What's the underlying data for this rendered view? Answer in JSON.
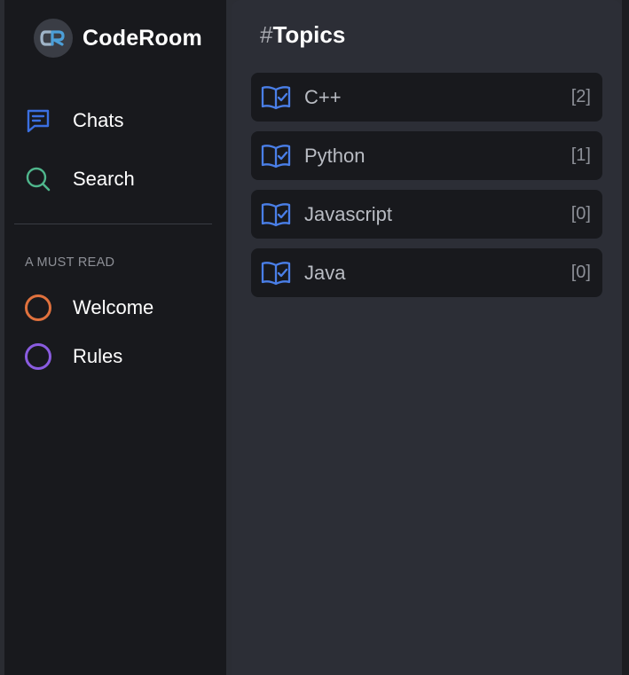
{
  "brand": {
    "name": "CodeRoom",
    "logo_text": "CR"
  },
  "nav": [
    {
      "label": "Chats",
      "icon": "chat-icon",
      "color": "#3b6fe0"
    },
    {
      "label": "Search",
      "icon": "search-icon",
      "color": "#4fb68c"
    }
  ],
  "must_read": {
    "label": "A MUST READ",
    "items": [
      {
        "label": "Welcome",
        "icon": "circle-icon",
        "color": "#e0713d"
      },
      {
        "label": "Rules",
        "icon": "circle-icon",
        "color": "#8a5ce0"
      }
    ]
  },
  "topics": {
    "hash": "#",
    "title": "Topics",
    "items": [
      {
        "name": "C++",
        "count": "[2]"
      },
      {
        "name": "Python",
        "count": "[1]"
      },
      {
        "name": "Javascript",
        "count": "[0]"
      },
      {
        "name": "Java",
        "count": "[0]"
      }
    ],
    "icon": "book-check-icon",
    "icon_color": "#4a7fe8"
  },
  "colors": {
    "sidebar_bg": "#18191d",
    "main_bg": "#2c2e36",
    "topic_bg": "#18191d"
  }
}
